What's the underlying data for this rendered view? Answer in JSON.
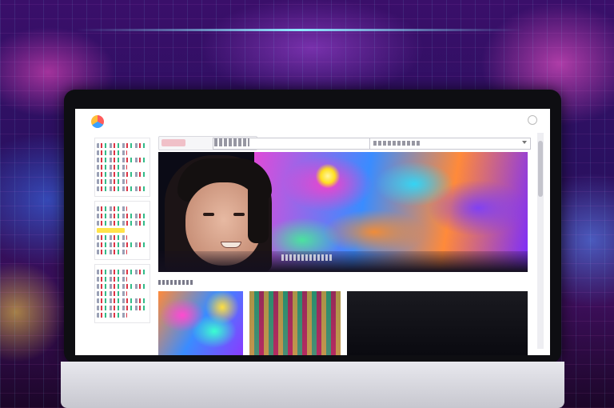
{
  "poster": {
    "headline": "",
    "subline": ""
  },
  "app": {
    "search": {
      "value": "",
      "placeholder": ""
    },
    "sort": {
      "selected": ""
    },
    "sidebar": {
      "heading": ""
    }
  },
  "colors": {
    "screen_bg": "#ffffff",
    "accent_pill": "#f0c0c8",
    "highlight_row": "#ffe34a"
  },
  "icons": {
    "logo": "app-logo-icon",
    "close": "close-icon",
    "chevron": "chevron-down-icon"
  }
}
